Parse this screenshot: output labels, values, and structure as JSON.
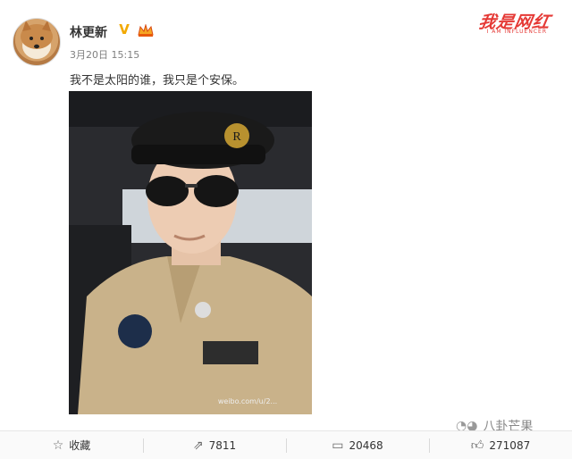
{
  "post": {
    "username": "林更新",
    "verified_icon": "V",
    "timestamp": "3月20日 15:15",
    "text": "我不是太阳的谁，我只是个安保。",
    "image_caption": "weibo.com/u/2..."
  },
  "watermark": {
    "title": "我是网红",
    "subtitle": "I AM INFLUENCER"
  },
  "actions": {
    "favorite_label": "收藏",
    "repost_count": "7811",
    "comment_count": "20468",
    "like_count": "271087"
  },
  "wechat_source": "八卦芒果",
  "colors": {
    "verified": "#f2a900",
    "watermark": "#e53935",
    "text": "#333333",
    "meta": "#808080"
  },
  "icons": {
    "favorite": "star-icon",
    "repost": "share-icon",
    "comment": "comment-icon",
    "like": "thumb-up-icon",
    "wechat": "wechat-icon"
  }
}
